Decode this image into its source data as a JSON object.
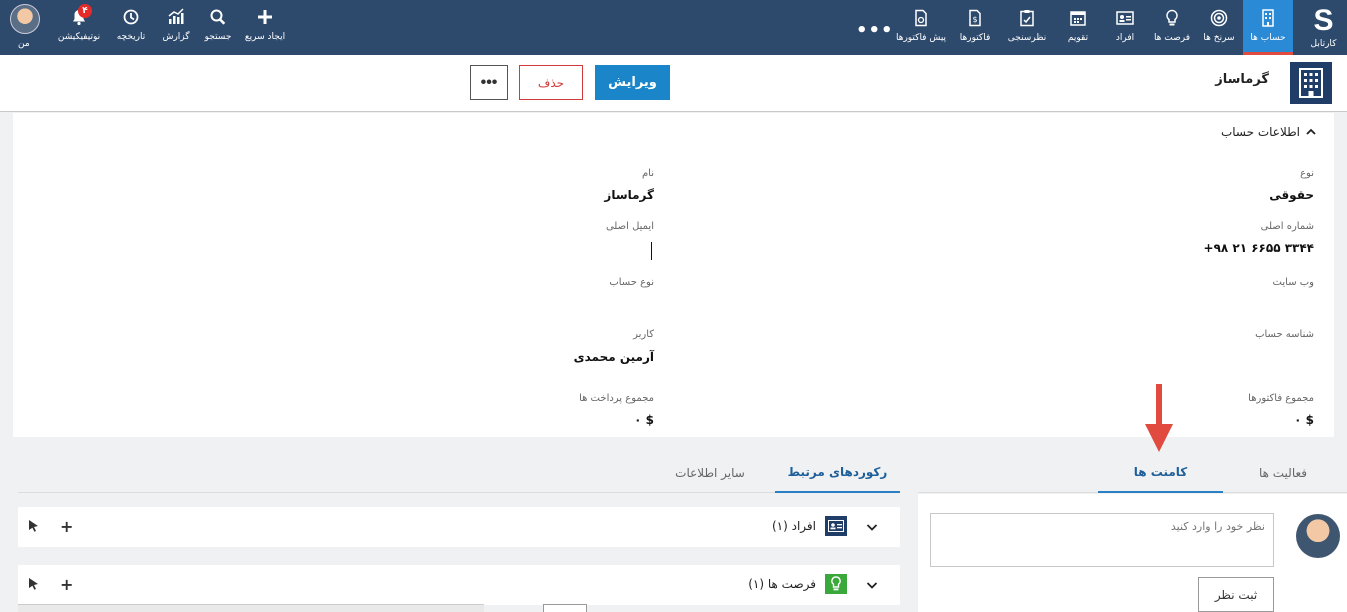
{
  "nav": {
    "logo_letter": "S",
    "items": [
      {
        "label": "کارتابل",
        "icon": "logo-s-icon"
      },
      {
        "label": "حساب ها",
        "icon": "building-icon",
        "active": true
      },
      {
        "label": "سرنخ ها",
        "icon": "target-icon"
      },
      {
        "label": "فرصت ها",
        "icon": "lightbulb-icon"
      },
      {
        "label": "افراد",
        "icon": "id-card-icon"
      },
      {
        "label": "تقویم",
        "icon": "calendar-icon"
      },
      {
        "label": "نظرسنجی",
        "icon": "clipboard-icon"
      },
      {
        "label": "فاکتورها",
        "icon": "invoice-icon"
      },
      {
        "label": "پیش فاکتورها",
        "icon": "pre-invoice-icon"
      }
    ],
    "more": "•••",
    "right_items": [
      {
        "label": "ایجاد سریع",
        "icon": "plus-icon"
      },
      {
        "label": "جستجو",
        "icon": "search-icon"
      },
      {
        "label": "گزارش",
        "icon": "chart-icon"
      },
      {
        "label": "تاریخچه",
        "icon": "history-icon"
      },
      {
        "label": "نوتیفیکیشن",
        "icon": "bell-icon",
        "badge": "۴"
      },
      {
        "label": "من",
        "icon": "avatar"
      }
    ]
  },
  "header": {
    "account_name": "گرماساز",
    "edit_label": "ویرایش",
    "delete_label": "حذف",
    "more_label": "•••"
  },
  "info": {
    "section_title": "اطلاعات حساب",
    "fields": {
      "type_label": "نوع",
      "type_value": "حقوقی",
      "name_label": "نام",
      "name_value": "گرماساز",
      "phone_label": "شماره اصلی",
      "phone_value": "+۹۸ ۲۱ ۶۶۵۵ ۳۳۴۴",
      "email_label": "ایمیل اصلی",
      "website_label": "وب سایت",
      "account_type_label": "نوع حساب",
      "account_id_label": "شناسه حساب",
      "user_label": "کاربر",
      "user_value": "آرمین محمدی",
      "invoices_total_label": "مجموع فاکتورها",
      "invoices_total_value": "$ ۰",
      "payments_total_label": "مجموع پرداخت ها",
      "payments_total_value": "$ ۰"
    }
  },
  "left_tabs": [
    {
      "label": "رکوردهای مرتبط",
      "active": true
    },
    {
      "label": "سایر اطلاعات",
      "active": false
    }
  ],
  "right_tabs": [
    {
      "label": "فعالیت ها",
      "active": false
    },
    {
      "label": "کامنت ها",
      "active": true
    }
  ],
  "related": [
    {
      "label": "افراد (۱)",
      "icon": "id-card-icon",
      "color": "#1f3d66"
    },
    {
      "label": "فرصت ها (۱)",
      "icon": "lightbulb-icon",
      "color": "#3aa83a"
    }
  ],
  "comment": {
    "placeholder": "نظر خود را وارد کنید",
    "submit_label": "ثبت نظر"
  },
  "colors": {
    "topbar": "#2d4a6d",
    "active_nav": "#2b8ad6",
    "accent": "#1a86c9",
    "danger": "#d13a3a",
    "arrow": "#e04a3f"
  }
}
